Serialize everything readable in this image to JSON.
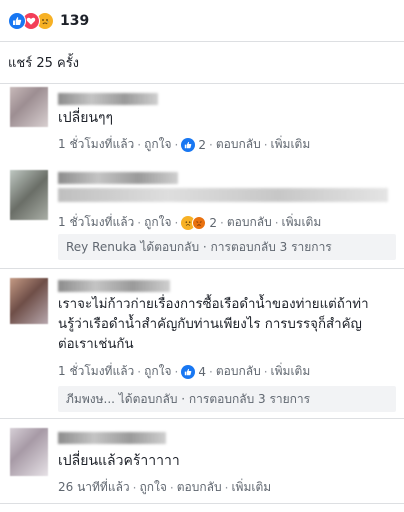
{
  "reactions": {
    "icons": [
      "like-icon",
      "love-icon",
      "sad-icon"
    ],
    "count": "139"
  },
  "shares": {
    "label": "แชร์ 25 ครั้ง"
  },
  "comments": [
    {
      "text": "เปลี่ยนๆๆ",
      "time": "1 ชั่วโมงที่แล้ว",
      "like_label": "ถูกใจ",
      "reply_label": "ตอบกลับ",
      "more_label": "เพิ่มเติม",
      "reaction_count": "2",
      "reaction_icons": [
        "like-icon"
      ]
    },
    {
      "text": "",
      "time": "1 ชั่วโมงที่แล้ว",
      "like_label": "ถูกใจ",
      "reply_label": "ตอบกลับ",
      "more_label": "เพิ่มเติม",
      "reaction_count": "2",
      "reaction_icons": [
        "sad-icon",
        "angry-icon"
      ],
      "replies": "Rey Renuka ได้ตอบกลับ · การตอบกลับ 3 รายการ"
    },
    {
      "text_line1": "เราจะไม่ก้าวก่ายเรื่องการซื้อเรือดำน้ำของท่ายแต่ถ้าท่า",
      "text_line2": "นรู้ว่าเรือดำน้ำสำคัญกับท่านเพียงไร การบรรจุก็สำคัญ",
      "text_line3": "ต่อเราเช่นกัน",
      "time": "1 ชั่วโมงที่แล้ว",
      "like_label": "ถูกใจ",
      "reply_label": "ตอบกลับ",
      "more_label": "เพิ่มเติม",
      "reaction_count": "4",
      "reaction_icons": [
        "like-icon"
      ],
      "replies": "ภีมพงษ... ได้ตอบกลับ · การตอบกลับ 3 รายการ"
    },
    {
      "text": "เปลี่ยนแล้วคร้าาาาา",
      "time": "26 นาทีที่แล้ว",
      "like_label": "ถูกใจ",
      "reply_label": "ตอบกลับ",
      "more_label": "เพิ่มเติม"
    }
  ],
  "separator": "·"
}
